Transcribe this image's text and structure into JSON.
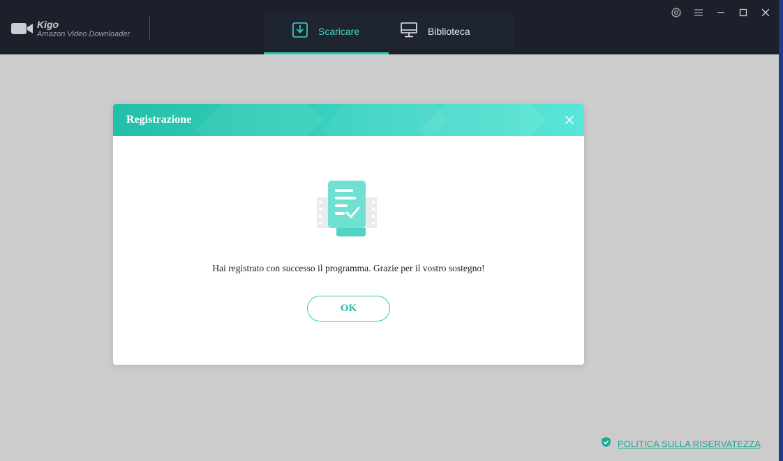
{
  "app": {
    "name": "Kigo",
    "subtitle": "Amazon Video Downloader"
  },
  "tabs": [
    {
      "label": "Scaricare",
      "icon": "download-icon",
      "active": true
    },
    {
      "label": "Biblioteca",
      "icon": "monitor-icon",
      "active": false
    }
  ],
  "window_controls": [
    "gear-icon",
    "menu-icon",
    "minimize-icon",
    "maximize-icon",
    "close-icon"
  ],
  "dialog": {
    "title": "Registrazione",
    "message": "Hai registrato con successo il programma. Grazie per il vostro sostegno!",
    "ok_label": "OK"
  },
  "footer": {
    "privacy_label": "POLITICA SULLA RISERVATEZZA",
    "icon": "shield-icon"
  },
  "colors": {
    "accent": "#31c8b5",
    "titlebar": "#1b202b",
    "background": "#cccccc"
  }
}
